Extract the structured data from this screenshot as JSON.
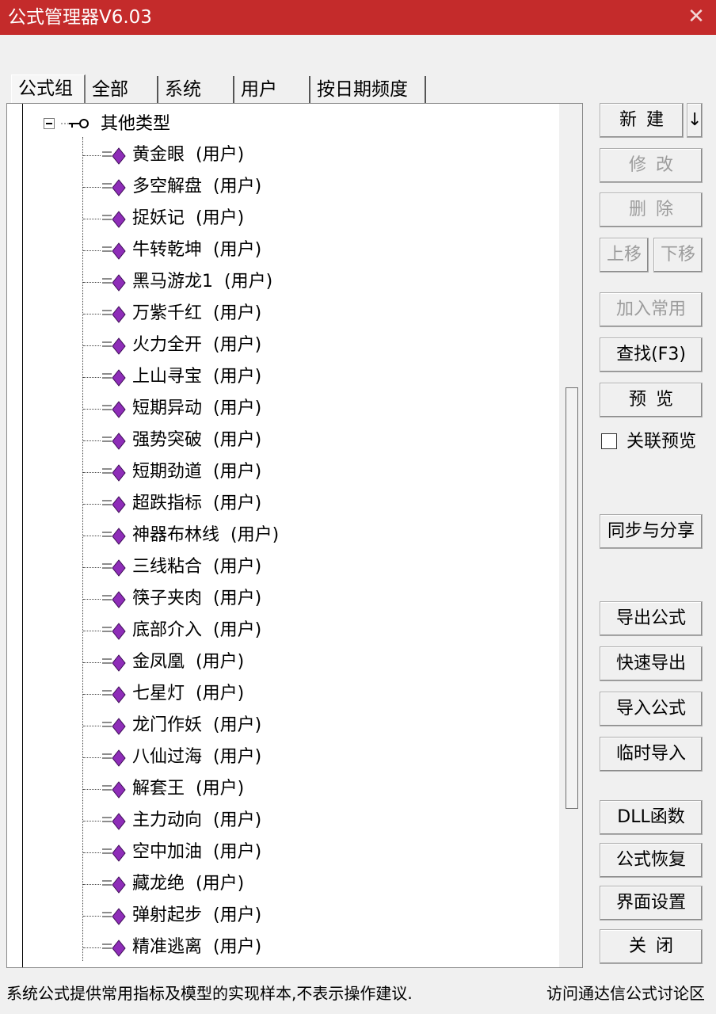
{
  "window": {
    "title": "公式管理器V6.03",
    "close_glyph": "✕"
  },
  "tabs": [
    "公式组",
    "全部",
    "系统",
    "用户",
    "按日期频度"
  ],
  "tree": {
    "group_label": "其他类型",
    "items": [
      "黄金眼  (用户)",
      "多空解盘  (用户)",
      "捉妖记  (用户)",
      "牛转乾坤  (用户)",
      "黑马游龙1  (用户)",
      "万紫千红  (用户)",
      "火力全开  (用户)",
      "上山寻宝  (用户)",
      "短期异动  (用户)",
      "强势突破  (用户)",
      "短期劲道  (用户)",
      "超跌指标  (用户)",
      "神器布林线  (用户)",
      "三线粘合  (用户)",
      "筷子夹肉  (用户)",
      "底部介入  (用户)",
      "金凤凰  (用户)",
      "七星灯  (用户)",
      "龙门作妖  (用户)",
      "八仙过海  (用户)",
      "解套王  (用户)",
      "主力动向  (用户)",
      "空中加油  (用户)",
      "藏龙绝  (用户)",
      "弹射起步  (用户)",
      "精准逃离  (用户)"
    ]
  },
  "buttons": {
    "new": "新建",
    "new_arrow": "↓",
    "modify": "修改",
    "delete": "删除",
    "move_up": "上移",
    "move_down": "下移",
    "add_common": "加入常用",
    "find": "查找(F3)",
    "preview": "预览",
    "linked_preview": "关联预览",
    "sync_share": "同步与分享",
    "export": "导出公式",
    "quick_export": "快速导出",
    "import": "导入公式",
    "temp_import": "临时导入",
    "dll": "DLL函数",
    "restore": "公式恢复",
    "ui_settings": "界面设置",
    "close": "关闭"
  },
  "status": {
    "left": "系统公式提供常用指标及模型的实现样本,不表示操作建议.",
    "link": "访问通达信公式讨论区"
  },
  "colors": {
    "title_bar": "#c42b2b",
    "item_icon": "#8e2db8"
  },
  "icons": {
    "group": "key-icon",
    "item": "formula-gem-icon"
  }
}
